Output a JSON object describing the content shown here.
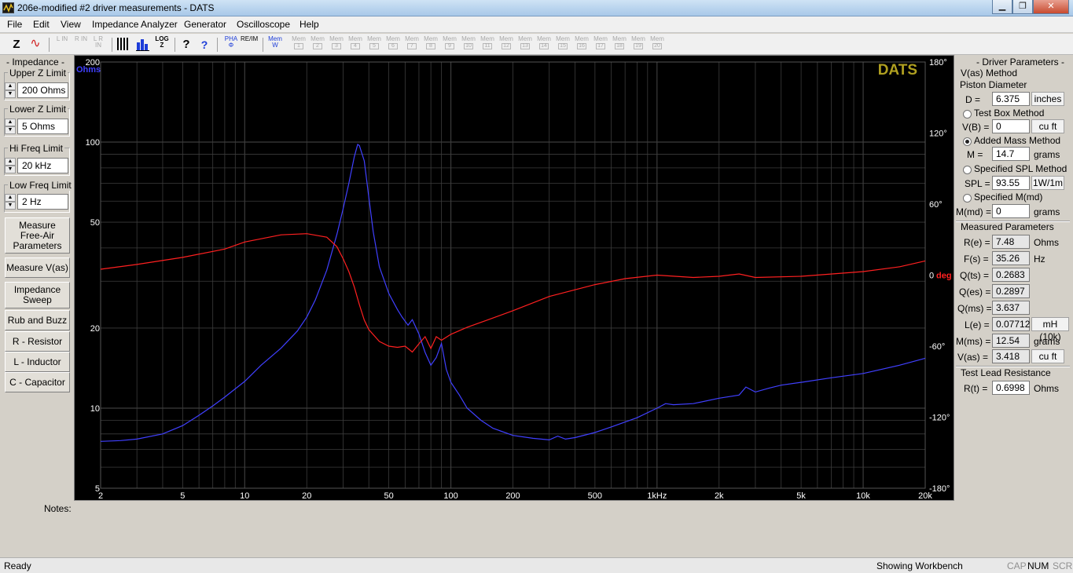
{
  "window": {
    "title": "206e-modified #2 driver measurements - DATS",
    "minimize": "▁",
    "maximize": "❐",
    "close": "✕"
  },
  "menu": [
    "File",
    "Edit",
    "View",
    "Impedance Analyzer",
    "Generator",
    "Oscilloscope",
    "Help"
  ],
  "toolbar": {
    "tools": [
      {
        "name": "z-button",
        "label": "Z",
        "icon": "impedance-z-icon"
      },
      {
        "name": "sine-button",
        "label": "∿",
        "icon": "sine-wave-icon"
      },
      {
        "name": "lin-button",
        "label": "L IN",
        "disabled": true
      },
      {
        "name": "rin-button",
        "label": "R IN",
        "disabled": true
      },
      {
        "name": "lrin-button",
        "label": "L R IN",
        "disabled": true
      },
      {
        "name": "bars-button",
        "label": "",
        "icon": "bars-icon"
      },
      {
        "name": "histogram-button",
        "label": "",
        "icon": "histogram-icon"
      },
      {
        "name": "log-button",
        "label": "LOG Z",
        "icon": "log-z-icon"
      },
      {
        "name": "help-button",
        "label": "?",
        "icon": "question-icon"
      },
      {
        "name": "context-help-button",
        "label": "?",
        "icon": "context-help-icon"
      },
      {
        "name": "pha-button",
        "label": "PHA Φ",
        "icon": "phase-icon"
      },
      {
        "name": "reim-button",
        "label": "RE/IM",
        "icon": "re-im-icon"
      },
      {
        "name": "mem-w-button",
        "label": "Mem W",
        "icon": "memory-write-icon"
      }
    ],
    "mem_slot_label": "Mem",
    "mem_slots": [
      "1",
      "2",
      "3",
      "4",
      "5",
      "6",
      "7",
      "8",
      "9",
      "10",
      "11",
      "12",
      "13",
      "14",
      "15",
      "16",
      "17",
      "18",
      "19",
      "20"
    ]
  },
  "left_panel": {
    "heading": "- Impedance -",
    "upper_z": {
      "label": "Upper Z Limit",
      "value": "200 Ohms"
    },
    "lower_z": {
      "label": "Lower Z Limit",
      "value": "5 Ohms"
    },
    "hi_freq": {
      "label": "Hi Freq Limit",
      "value": "20 kHz"
    },
    "low_freq": {
      "label": "Low Freq Limit",
      "value": "2 Hz"
    },
    "buttons": {
      "measure_free_air": "Measure Free-Air Parameters",
      "measure_vas": "Measure V(as)",
      "impedance_sweep": "Impedance Sweep",
      "rub_buzz": "Rub and Buzz",
      "resistor": "R - Resistor",
      "inductor": "L - Inductor",
      "capacitor": "C - Capacitor"
    },
    "spin_up": "▲",
    "spin_down": "▼"
  },
  "chart_data": {
    "type": "line",
    "title": "",
    "brand": "DATS",
    "x_scale": "log",
    "xlim": [
      2,
      20000
    ],
    "x_ticks": [
      "2",
      "5",
      "10",
      "20",
      "50",
      "100",
      "200",
      "500",
      "1kHz",
      "2k",
      "5k",
      "10k",
      "20k"
    ],
    "x_tick_values": [
      2,
      5,
      10,
      20,
      50,
      100,
      200,
      500,
      1000,
      2000,
      5000,
      10000,
      20000
    ],
    "left_axis": {
      "label": "Ohms",
      "scale": "log",
      "range": [
        5,
        200
      ],
      "ticks": [
        "200",
        "100",
        "50",
        "20",
        "10",
        "5"
      ],
      "tick_values": [
        200,
        100,
        50,
        20,
        10,
        5
      ]
    },
    "right_axis": {
      "label": "deg",
      "range": [
        -180,
        180
      ],
      "ticks": [
        "180°",
        "120°",
        "60°",
        "0",
        "-60°",
        "-120°",
        "-180°"
      ],
      "tick_values": [
        180,
        120,
        60,
        0,
        -60,
        -120,
        -180
      ]
    },
    "grid": true,
    "colors": {
      "impedance": "#4040ff",
      "phase": "#ff2020",
      "grid": "#3c3c3c",
      "axis_text": "#ffffff",
      "brand": "#b0a020"
    },
    "series": [
      {
        "name": "Impedance",
        "axis": "left",
        "x": [
          2,
          2.5,
          3,
          4,
          5,
          6,
          7,
          8,
          10,
          12,
          15,
          18,
          20,
          22,
          25,
          28,
          30,
          32,
          34,
          35.3,
          36,
          38,
          40,
          42,
          45,
          50,
          55,
          58,
          62,
          65,
          70,
          75,
          80,
          85,
          90,
          95,
          100,
          110,
          120,
          140,
          160,
          200,
          250,
          300,
          330,
          360,
          400,
          500,
          600,
          800,
          1000,
          1100,
          1200,
          1500,
          2000,
          2500,
          2700,
          3000,
          3500,
          4000,
          5000,
          7000,
          10000,
          15000,
          20000
        ],
        "values": [
          7.5,
          7.55,
          7.65,
          8,
          8.6,
          9.4,
          10.2,
          11,
          12.6,
          14.5,
          16.8,
          19.5,
          22,
          25.5,
          33,
          45,
          56,
          70,
          88,
          98,
          97,
          85,
          62,
          46,
          34,
          27,
          23.5,
          22,
          20.5,
          21.5,
          19,
          16.2,
          14.5,
          15.5,
          17.5,
          14,
          12.5,
          11.2,
          10,
          9,
          8.4,
          7.9,
          7.7,
          7.6,
          7.85,
          7.65,
          7.75,
          8.1,
          8.5,
          9.2,
          10,
          10.4,
          10.3,
          10.4,
          10.9,
          11.2,
          12,
          11.5,
          11.9,
          12.2,
          12.5,
          13,
          13.5,
          14.5,
          15.4
        ]
      },
      {
        "name": "Phase",
        "axis": "right",
        "x": [
          2,
          3,
          5,
          8,
          10,
          15,
          20,
          25,
          28,
          30,
          32,
          34,
          36,
          38,
          40,
          45,
          50,
          55,
          60,
          65,
          70,
          75,
          80,
          85,
          90,
          100,
          120,
          150,
          200,
          300,
          500,
          700,
          1000,
          1500,
          2000,
          2500,
          3000,
          5000,
          10000,
          15000,
          20000
        ],
        "values": [
          5,
          9,
          15,
          22,
          28,
          34,
          35,
          32,
          24,
          14,
          3,
          -10,
          -25,
          -38,
          -46,
          -56,
          -60,
          -61,
          -60,
          -65,
          -58,
          -52,
          -62,
          -52,
          -55,
          -50,
          -44,
          -38,
          -30,
          -18,
          -8,
          -3,
          0,
          -2,
          -1,
          1,
          -2,
          -1,
          3,
          7,
          12
        ]
      }
    ]
  },
  "right_panel": {
    "heading": "- Driver Parameters -",
    "vas_method": "V(as) Method",
    "piston_diameter": "Piston Diameter",
    "d": {
      "label": "D =",
      "value": "6.375",
      "unit": "inches"
    },
    "test_box": "Test Box Method",
    "vb": {
      "label": "V(B) =",
      "value": "0",
      "unit": "cu ft"
    },
    "added_mass": "Added Mass Method",
    "m": {
      "label": "M =",
      "value": "14.7",
      "unit": "grams"
    },
    "specified_spl": "Specified SPL Method",
    "spl": {
      "label": "SPL =",
      "value": "93.55",
      "unit": "1W/1m"
    },
    "specified_mmd": "Specified M(md)",
    "mmd": {
      "label": "M(md) =",
      "value": "0",
      "unit": "grams"
    },
    "measured_heading": "Measured Parameters",
    "re": {
      "label": "R(e) =",
      "value": "7.48",
      "unit": "Ohms"
    },
    "fs": {
      "label": "F(s) =",
      "value": "35.26",
      "unit": "Hz"
    },
    "qts": {
      "label": "Q(ts) =",
      "value": "0.2683"
    },
    "qes": {
      "label": "Q(es) =",
      "value": "0.2897"
    },
    "qms": {
      "label": "Q(ms) =",
      "value": "3.637"
    },
    "le": {
      "label": "L(e) =",
      "value": "0.07712",
      "unit": "mH (10k)"
    },
    "mms": {
      "label": "M(ms) =",
      "value": "12.54",
      "unit": "grams"
    },
    "vas": {
      "label": "V(as) =",
      "value": "3.418",
      "unit": "cu ft"
    },
    "test_lead_heading": "Test Lead Resistance",
    "rt": {
      "label": "R(t) =",
      "value": "0.6998",
      "unit": "Ohms"
    }
  },
  "notes_label": "Notes:",
  "status": {
    "left": "Ready",
    "workbench": "Showing Workbench",
    "cap": "CAP",
    "num": "NUM",
    "scrl": "SCRL"
  }
}
